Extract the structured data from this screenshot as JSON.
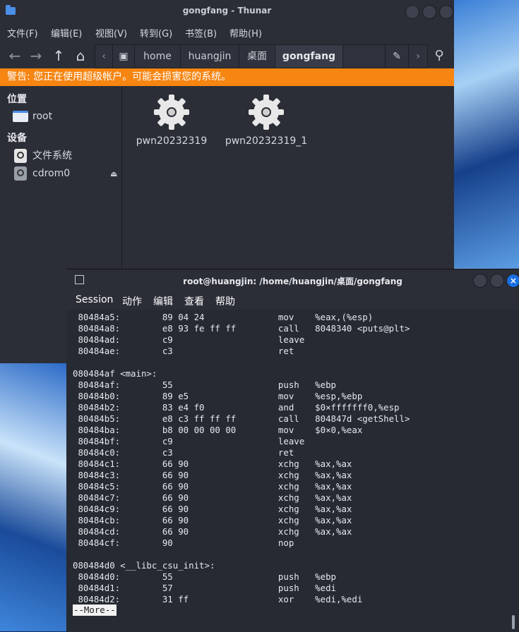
{
  "thunar": {
    "title": "gongfang - Thunar",
    "menu": [
      "文件(F)",
      "编辑(E)",
      "视图(V)",
      "转到(G)",
      "书签(B)",
      "帮助(H)"
    ],
    "breadcrumbs": [
      "home",
      "huangjin",
      "桌面",
      "gongfang"
    ],
    "warning": "警告: 您正在使用超级帐户。可能会损害您的系统。",
    "sidebar": {
      "places_header": "位置",
      "places": [
        {
          "label": "root",
          "icon": "folder-icon"
        }
      ],
      "devices_header": "设备",
      "devices": [
        {
          "label": "文件系统",
          "icon": "disk-icon"
        },
        {
          "label": "cdrom0",
          "icon": "cdrom-icon"
        }
      ]
    },
    "files": [
      "pwn20232319",
      "pwn20232319_1"
    ]
  },
  "terminal": {
    "title": "root@huangjin: /home/huangjin/桌面/gongfang",
    "menu": [
      "Session",
      "动作",
      "编辑",
      "查看",
      "帮助"
    ],
    "lines": [
      " 80484a5:\t89 04 24             \tmov    %eax,(%esp)",
      " 80484a8:\te8 93 fe ff ff       \tcall   8048340 <puts@plt>",
      " 80484ad:\tc9                   \tleave",
      " 80484ae:\tc3                   \tret",
      "",
      "080484af <main>:",
      " 80484af:\t55                   \tpush   %ebp",
      " 80484b0:\t89 e5                \tmov    %esp,%ebp",
      " 80484b2:\t83 e4 f0             \tand    $0×fffffff0,%esp",
      " 80484b5:\te8 c3 ff ff ff       \tcall   804847d <getShell>",
      " 80484ba:\tb8 00 00 00 00       \tmov    $0×0,%eax",
      " 80484bf:\tc9                   \tleave",
      " 80484c0:\tc3                   \tret",
      " 80484c1:\t66 90                \txchg   %ax,%ax",
      " 80484c3:\t66 90                \txchg   %ax,%ax",
      " 80484c5:\t66 90                \txchg   %ax,%ax",
      " 80484c7:\t66 90                \txchg   %ax,%ax",
      " 80484c9:\t66 90                \txchg   %ax,%ax",
      " 80484cb:\t66 90                \txchg   %ax,%ax",
      " 80484cd:\t66 90                \txchg   %ax,%ax",
      " 80484cf:\t90                   \tnop",
      "",
      "080484d0 <__libc_csu_init>:",
      " 80484d0:\t55                   \tpush   %ebp",
      " 80484d1:\t57                   \tpush   %edi",
      " 80484d2:\t31 ff                \txor    %edi,%edi"
    ],
    "pager": "--More--"
  },
  "colors": {
    "warning_bg": "#f68512",
    "accent": "#1a6fe0",
    "window_bg": "#2b2e37",
    "terminal_bg": "#262a33"
  }
}
